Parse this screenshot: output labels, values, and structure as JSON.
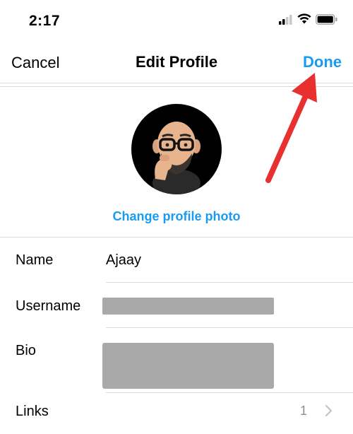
{
  "status_bar": {
    "time": "2:17",
    "icons": [
      "cellular-signal-icon",
      "wifi-icon",
      "battery-icon"
    ]
  },
  "nav": {
    "cancel_label": "Cancel",
    "title": "Edit Profile",
    "done_label": "Done"
  },
  "profile": {
    "change_photo_label": "Change profile photo",
    "avatar": "memoji-avatar"
  },
  "fields": [
    {
      "label": "Name",
      "value": "Ajaay"
    },
    {
      "label": "Username",
      "value": ""
    },
    {
      "label": "Bio",
      "value": ""
    },
    {
      "label": "Links",
      "value": "1"
    }
  ],
  "colors": {
    "accent": "#1a9bf0",
    "annotation_arrow": "#e8302f",
    "redaction": "#a9a9a9",
    "separator": "#dcdcdc"
  }
}
